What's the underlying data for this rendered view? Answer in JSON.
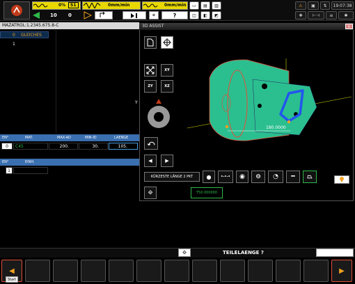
{
  "topbar": {
    "spindle_pct": "0%",
    "spindle_code": "S1",
    "feed_rate": "0mm/min",
    "feed_rate2": "0mm/min",
    "tool_no": "10",
    "tool_val": "0",
    "help_label": "?",
    "clock": "19:07:38"
  },
  "program": {
    "title": "MAZATROL:1.2345.675.8-C",
    "row0_no": "0",
    "row0_text": "GLEICHES",
    "row1_no": "1"
  },
  "mat_table": {
    "headers": [
      "EN°",
      "MAT.",
      "MAX-AD",
      "MIN-ID",
      "LAENGE"
    ],
    "row": [
      "0",
      "C45",
      "200.",
      "30.",
      "105."
    ]
  },
  "einh_table": {
    "headers": [
      "EN°",
      "EINH."
    ],
    "row": [
      "1",
      ""
    ]
  },
  "assist": {
    "title": "3D ASSIST",
    "view_labels": [
      "XY",
      "ZY",
      "XZ"
    ],
    "dimension": "180.0000",
    "measure_label": "KÜRZESTE LÄNGE 2 PKT",
    "readout": "T50.000000",
    "axis_label": "Y"
  },
  "status": {
    "prompt": "TEILELAENGE ?",
    "start_label": "Start"
  },
  "colors": {
    "workpiece": "#2bbf8f",
    "edge": "#e0503a",
    "highlight": "#2255ee",
    "accent_green": "#2fb84a",
    "orange": "#f0a020",
    "header_blue": "#3a6fb0"
  }
}
